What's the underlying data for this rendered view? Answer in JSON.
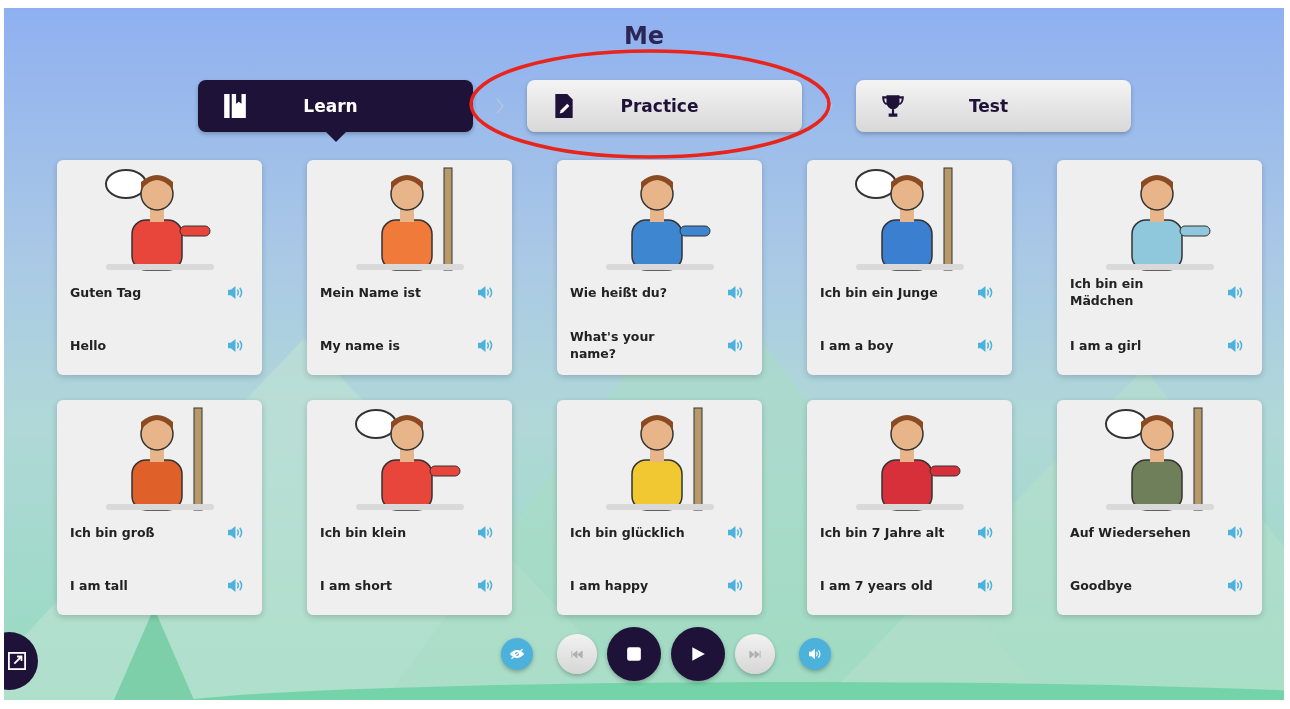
{
  "title": "Me",
  "tabs": [
    {
      "label": "Learn",
      "kind": "book",
      "selected": true
    },
    {
      "label": "Practice",
      "kind": "worksheet",
      "selected": false
    },
    {
      "label": "Test",
      "kind": "trophy",
      "selected": false
    }
  ],
  "cards": [
    {
      "german": "Guten Tag",
      "english": "Hello"
    },
    {
      "german": "Mein Name ist",
      "english": "My name is"
    },
    {
      "german": "Wie heißt du?",
      "english": "What's your name?"
    },
    {
      "german": "Ich bin ein Junge",
      "english": "I am a boy"
    },
    {
      "german": "Ich bin ein Mädchen",
      "english": "I am a girl"
    },
    {
      "german": "Ich bin groß",
      "english": "I am tall"
    },
    {
      "german": "Ich bin klein",
      "english": "I am short"
    },
    {
      "german": "Ich bin glücklich",
      "english": "I am happy"
    },
    {
      "german": "Ich bin 7 Jahre alt",
      "english": "I am 7 years old"
    },
    {
      "german": "Auf Wiedersehen",
      "english": "Goodbye"
    }
  ],
  "controls": [
    {
      "kind": "hide",
      "disabled": false
    },
    {
      "kind": "previous",
      "disabled": true
    },
    {
      "kind": "stop",
      "disabled": false
    },
    {
      "kind": "play",
      "disabled": false
    },
    {
      "kind": "next",
      "disabled": true
    },
    {
      "kind": "audio",
      "disabled": false
    }
  ]
}
